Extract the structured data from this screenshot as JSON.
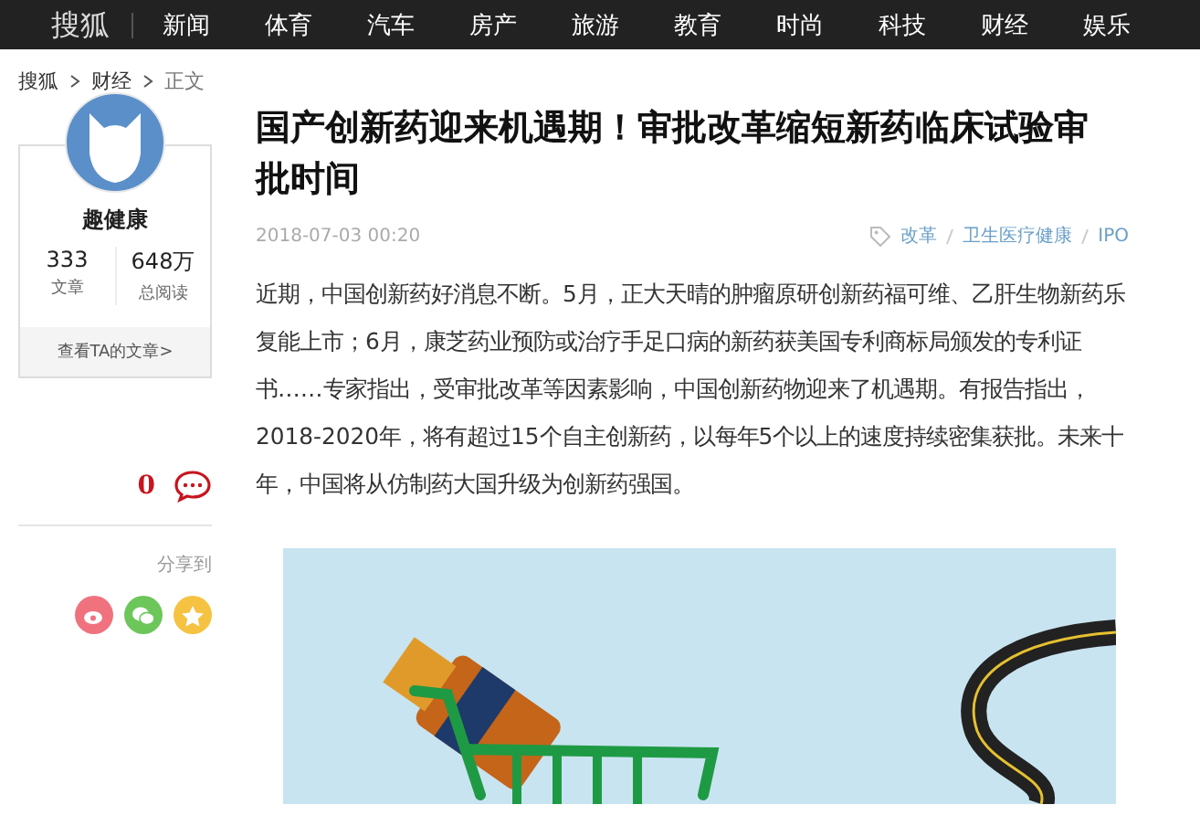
{
  "nav": {
    "logo": "搜狐",
    "items": [
      "新闻",
      "体育",
      "汽车",
      "房产",
      "旅游",
      "教育",
      "时尚",
      "科技",
      "财经",
      "娱乐"
    ]
  },
  "breadcrumb": [
    "搜狐",
    "财经",
    "正文"
  ],
  "author": {
    "name": "趣健康",
    "stats": [
      {
        "value": "333",
        "label": "文章"
      },
      {
        "value": "648万",
        "label": "总阅读"
      }
    ],
    "link": "查看TA的文章>"
  },
  "comments": {
    "count": "0"
  },
  "share": {
    "label": "分享到",
    "targets": [
      {
        "kind": "weibo",
        "color": "#f0727f"
      },
      {
        "kind": "wechat",
        "color": "#6dc65a"
      },
      {
        "kind": "favorite",
        "color": "#f5c242"
      }
    ]
  },
  "article": {
    "title": "国产创新药迎来机遇期！审批改革缩短新药临床试验审批时间",
    "date": "2018-07-03 00:20",
    "tags": [
      "改革",
      "卫生医疗健康",
      "IPO"
    ],
    "body": "近期，中国创新药好消息不断。5月，正大天晴的肿瘤原研创新药福可维、乙肝生物新药乐复能上市；6月，康芝药业预防或治疗手足口病的新药获美国专利商标局颁发的专利证书……专家指出，受审批改革等因素影响，中国创新药物迎来了机遇期。有报告指出，2018-2020年，将有超过15个自主创新药，以每年5个以上的速度持续密集获批。未来十年，中国将从仿制药大国升级为创新药强国。"
  }
}
